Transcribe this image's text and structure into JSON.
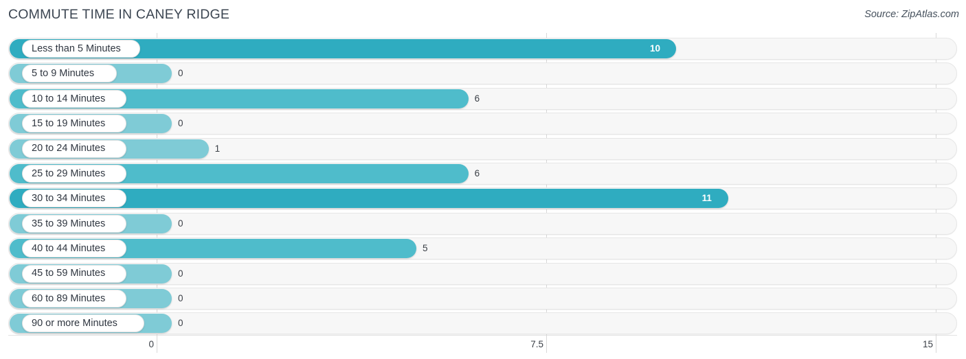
{
  "header": {
    "title": "COMMUTE TIME IN CANEY RIDGE",
    "source": "Source: ZipAtlas.com"
  },
  "colors": {
    "bar_dark": "#2FACC0",
    "bar_mid": "#4FBCCB",
    "bar_light": "#7FCBD6",
    "track": "#F7F7F7",
    "track_border": "#E6E6E6",
    "gridline": "#D8D8D8",
    "value_inside": "#FFFFFF",
    "value_outside": "#3A3F46",
    "title": "#3C4652"
  },
  "chart_data": {
    "type": "bar",
    "orientation": "horizontal",
    "title": "COMMUTE TIME IN CANEY RIDGE",
    "xlabel": "",
    "ylabel": "",
    "xlim": [
      0,
      15
    ],
    "xticks": [
      0,
      7.5,
      15
    ],
    "xtick_labels": [
      "0",
      "7.5",
      "15"
    ],
    "grid": true,
    "legend": false,
    "categories": [
      "Less than 5 Minutes",
      "5 to 9 Minutes",
      "10 to 14 Minutes",
      "15 to 19 Minutes",
      "20 to 24 Minutes",
      "25 to 29 Minutes",
      "30 to 34 Minutes",
      "35 to 39 Minutes",
      "40 to 44 Minutes",
      "45 to 59 Minutes",
      "60 to 89 Minutes",
      "90 or more Minutes"
    ],
    "values": [
      10,
      0,
      6,
      0,
      1,
      6,
      11,
      0,
      5,
      0,
      0,
      0
    ],
    "value_labels": [
      "10",
      "0",
      "6",
      "0",
      "1",
      "6",
      "11",
      "0",
      "5",
      "0",
      "0",
      "0"
    ]
  },
  "rows": [
    {
      "label": "Less than 5 Minutes",
      "value": 10,
      "value_label": "10",
      "label_inside": true,
      "shade": "dark",
      "pill_width": 172
    },
    {
      "label": "5 to 9 Minutes",
      "value": 0,
      "value_label": "0",
      "label_inside": false,
      "shade": "light",
      "pill_width": 138
    },
    {
      "label": "10 to 14 Minutes",
      "value": 6,
      "value_label": "6",
      "label_inside": false,
      "shade": "mid",
      "pill_width": 152
    },
    {
      "label": "15 to 19 Minutes",
      "value": 0,
      "value_label": "0",
      "label_inside": false,
      "shade": "light",
      "pill_width": 152
    },
    {
      "label": "20 to 24 Minutes",
      "value": 1,
      "value_label": "1",
      "label_inside": false,
      "shade": "light",
      "pill_width": 152
    },
    {
      "label": "25 to 29 Minutes",
      "value": 6,
      "value_label": "6",
      "label_inside": false,
      "shade": "mid",
      "pill_width": 152
    },
    {
      "label": "30 to 34 Minutes",
      "value": 11,
      "value_label": "11",
      "label_inside": true,
      "shade": "dark",
      "pill_width": 152
    },
    {
      "label": "35 to 39 Minutes",
      "value": 0,
      "value_label": "0",
      "label_inside": false,
      "shade": "light",
      "pill_width": 152
    },
    {
      "label": "40 to 44 Minutes",
      "value": 5,
      "value_label": "5",
      "label_inside": false,
      "shade": "mid",
      "pill_width": 152
    },
    {
      "label": "45 to 59 Minutes",
      "value": 0,
      "value_label": "0",
      "label_inside": false,
      "shade": "light",
      "pill_width": 152
    },
    {
      "label": "60 to 89 Minutes",
      "value": 0,
      "value_label": "0",
      "label_inside": false,
      "shade": "light",
      "pill_width": 152
    },
    {
      "label": "90 or more Minutes",
      "value": 0,
      "value_label": "0",
      "label_inside": false,
      "shade": "light",
      "pill_width": 178
    }
  ]
}
